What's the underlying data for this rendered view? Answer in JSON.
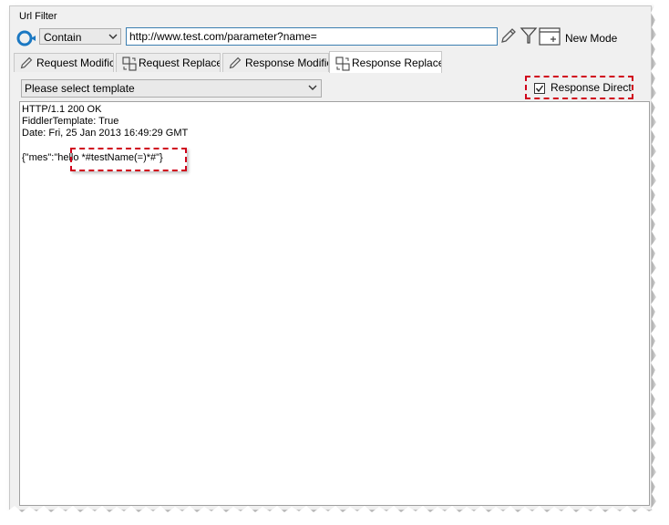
{
  "group": {
    "label": "Url Filter"
  },
  "filter": {
    "match_value": "Contain",
    "url_value": "http://www.test.com/parameter?name=",
    "new_mode_label": "New Mode"
  },
  "tabs": [
    {
      "label": "Request Modific",
      "icon": "pencil-icon"
    },
    {
      "label": "Request Replace",
      "icon": "replace-icon"
    },
    {
      "label": "Response Modific",
      "icon": "pencil-icon"
    },
    {
      "label": "Response Replace",
      "icon": "replace-icon",
      "active": true
    }
  ],
  "template": {
    "placeholder": "Please select template"
  },
  "response_direct": {
    "label": "Response Direct",
    "checked": true
  },
  "editor": {
    "lines": [
      "HTTP/1.1 200 OK",
      "FiddlerTemplate: True",
      "Date: Fri, 25 Jan 2013 16:49:29 GMT",
      "",
      "{\"mes\":\"hello *#testName(=)*#\"}"
    ]
  },
  "colors": {
    "highlight": "#d0021b",
    "accent": "#1b78c2",
    "input_border": "#3c7fb1"
  }
}
